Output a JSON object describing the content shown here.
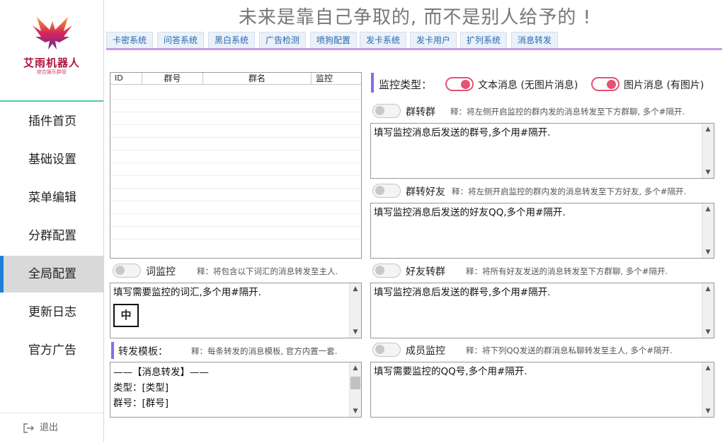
{
  "app": {
    "logo_title": "艾雨机器人",
    "logo_subtitle": "综合娱乐群管",
    "banner": "未来是靠自己争取的, 而不是别人给予的 !"
  },
  "sidebar": {
    "items": [
      {
        "label": "插件首页"
      },
      {
        "label": "基础设置"
      },
      {
        "label": "菜单编辑"
      },
      {
        "label": "分群配置"
      },
      {
        "label": "全局配置",
        "active": true
      },
      {
        "label": "更新日志"
      },
      {
        "label": "官方广告"
      }
    ],
    "logout_label": "退出"
  },
  "tabs": [
    {
      "label": "卡密系统"
    },
    {
      "label": "问答系统"
    },
    {
      "label": "黑白系统"
    },
    {
      "label": "广告检测"
    },
    {
      "label": "喷狗配置"
    },
    {
      "label": "发卡系统"
    },
    {
      "label": "发卡用户"
    },
    {
      "label": "扩列系统"
    },
    {
      "label": "消息转发"
    }
  ],
  "table": {
    "columns": [
      "ID",
      "群号",
      "群名",
      "监控"
    ]
  },
  "monitor_type": {
    "label": "监控类型：",
    "text_msg": "文本消息 (无图片消息)",
    "image_msg": "图片消息 (有图片)"
  },
  "group_to_group": {
    "label": "群转群",
    "note": "释：将左侧开启监控的群内发的消息转发至下方群聊, 多个#隔开.",
    "placeholder": "填写监控消息后发送的群号,多个用#隔开."
  },
  "group_to_friend": {
    "label": "群转好友",
    "note": "释：将左侧开启监控的群内发的消息转发至下方好友, 多个#隔开.",
    "placeholder": "填写监控消息后发送的好友QQ,多个用#隔开."
  },
  "word_monitor": {
    "label": "词监控",
    "note": "释：将包含以下词汇的消息转发至主人.",
    "placeholder": "填写需要监控的词汇,多个用#隔开.",
    "ime_badge": "中"
  },
  "friend_to_group": {
    "label": "好友转群",
    "note": "释：将所有好友发送的消息转发至下方群聊, 多个#隔开.",
    "placeholder": "填写监控消息后发送的群号,多个用#隔开."
  },
  "forward_template": {
    "label": "转发模板：",
    "note": "释：每条转发的消息模板, 官方内置一套.",
    "lines": [
      "——【消息转发】——",
      "类型：[类型]",
      "群号：[群号]"
    ]
  },
  "member_monitor": {
    "label": "成员监控",
    "note": "释：将下列QQ发送的群消息私聊转发至主人, 多个#隔开.",
    "placeholder": "填写需要监控的QQ号,多个用#隔开."
  },
  "colors": {
    "accent": "#e55374",
    "tab_text": "#2a68b3",
    "tab_underline": "#c79be8",
    "section_bar": "#7a73e6",
    "sidebar_active_bar": "#1e7fd8"
  }
}
